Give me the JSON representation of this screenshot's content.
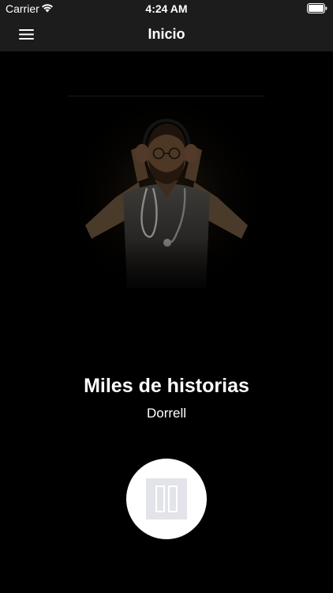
{
  "status_bar": {
    "carrier": "Carrier",
    "time": "4:24 AM",
    "wifi_icon": "wifi-icon",
    "battery_icon": "battery-icon"
  },
  "nav_bar": {
    "title": "Inicio",
    "menu_icon": "hamburger-menu-icon"
  },
  "player": {
    "artwork": "podcast-cover-doctor-with-headphones",
    "title": "Miles de historias",
    "artist": "Dorrell",
    "control_icon": "pause-icon",
    "is_playing": true
  },
  "colors": {
    "background": "#000000",
    "bar_background": "#1c1c1c",
    "text": "#ffffff",
    "button": "#ffffff",
    "icon_fill": "#e3e3ea"
  }
}
